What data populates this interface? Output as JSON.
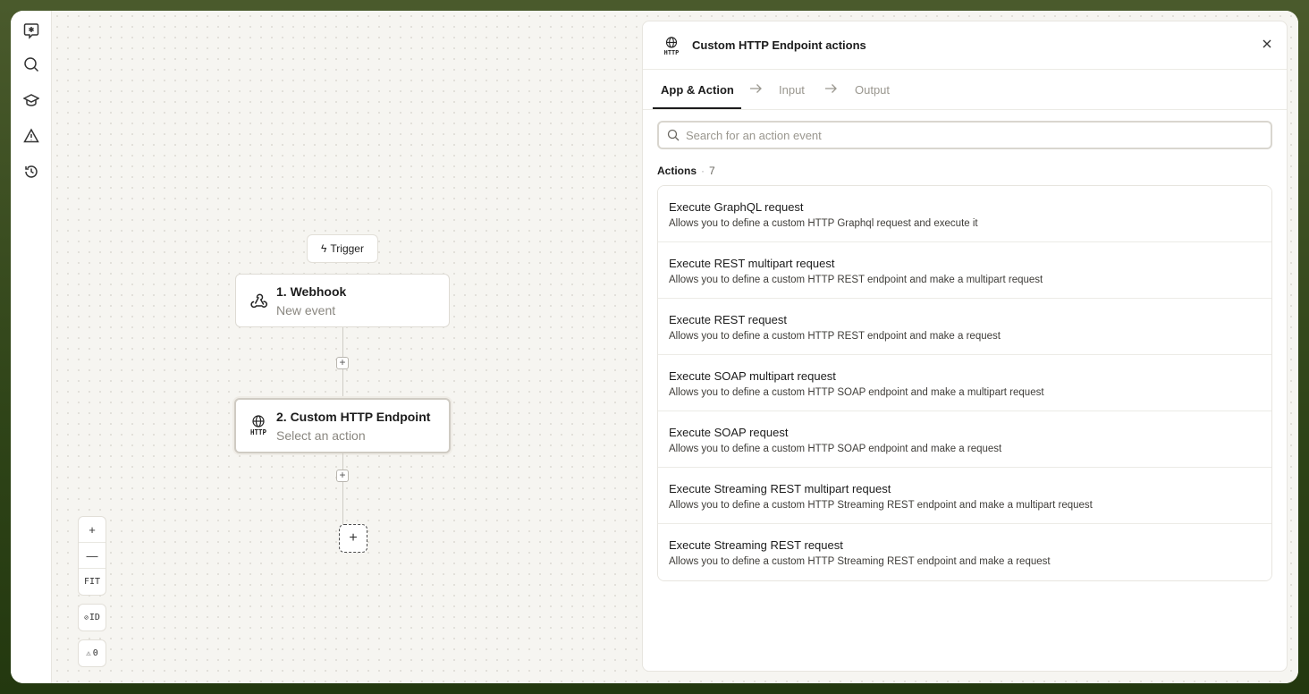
{
  "sidebar": {
    "items": [
      {
        "name": "logo-icon"
      },
      {
        "name": "search-icon"
      },
      {
        "name": "academy-icon"
      },
      {
        "name": "alert-icon"
      },
      {
        "name": "history-icon"
      }
    ]
  },
  "canvas": {
    "trigger_label": "Trigger",
    "nodes": [
      {
        "title": "1. Webhook",
        "subtitle": "New event",
        "icon": "webhook-icon"
      },
      {
        "title": "2. Custom HTTP Endpoint",
        "subtitle": "Select an action",
        "icon": "http-icon"
      }
    ],
    "controls": {
      "zoom_in": "+",
      "zoom_out": "—",
      "fit": "FIT",
      "id_toggle": "ID",
      "warnings": "0"
    }
  },
  "panel": {
    "title": "Custom HTTP Endpoint actions",
    "tabs": [
      {
        "label": "App & Action",
        "active": true
      },
      {
        "label": "Input",
        "active": false
      },
      {
        "label": "Output",
        "active": false
      }
    ],
    "search": {
      "placeholder": "Search for an action event",
      "value": ""
    },
    "section_label": "Actions",
    "section_count": "7",
    "actions": [
      {
        "name": "Execute GraphQL request",
        "description": "Allows you to define a custom HTTP Graphql request and execute it"
      },
      {
        "name": "Execute REST multipart request",
        "description": "Allows you to define a custom HTTP REST endpoint and make a multipart request"
      },
      {
        "name": "Execute REST request",
        "description": "Allows you to define a custom HTTP REST endpoint and make a request"
      },
      {
        "name": "Execute SOAP multipart request",
        "description": "Allows you to define a custom HTTP SOAP endpoint and make a multipart request"
      },
      {
        "name": "Execute SOAP request",
        "description": "Allows you to define a custom HTTP SOAP endpoint and make a request"
      },
      {
        "name": "Execute Streaming REST multipart request",
        "description": "Allows you to define a custom HTTP Streaming REST endpoint and make a multipart request"
      },
      {
        "name": "Execute Streaming REST request",
        "description": "Allows you to define a custom HTTP Streaming REST endpoint and make a request"
      }
    ]
  },
  "colors": {
    "background_frame": "#3b4d22",
    "canvas": "#f6f5f1",
    "text_primary": "#1c1c1c",
    "text_muted": "#9a978f"
  }
}
